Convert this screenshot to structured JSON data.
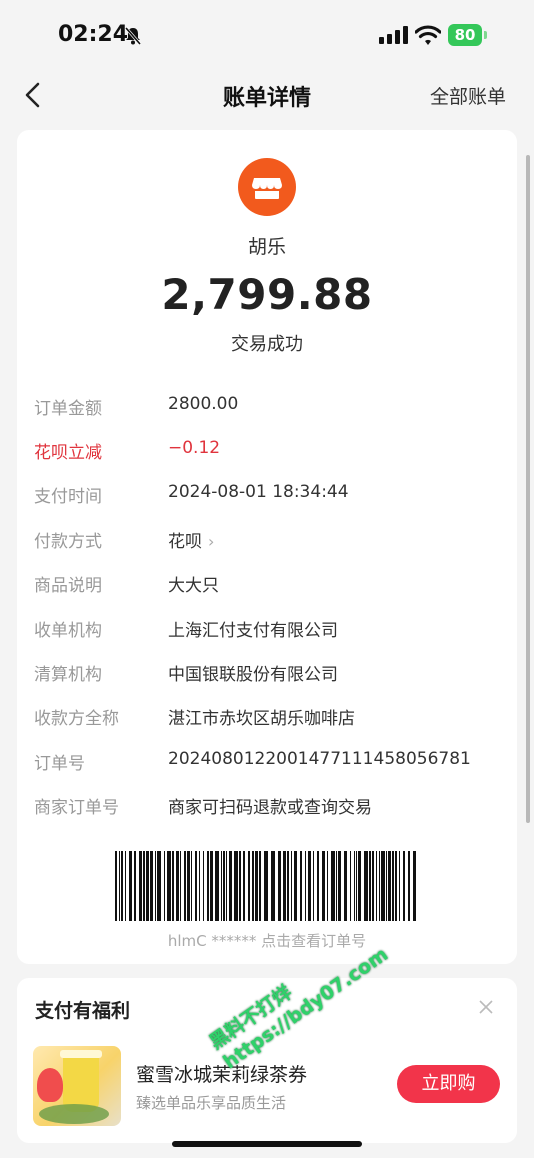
{
  "status_bar": {
    "time": "02:24",
    "battery": "80"
  },
  "nav": {
    "title": "账单详情",
    "right_link": "全部账单"
  },
  "bill": {
    "merchant": "胡乐",
    "amount": "2,799.88",
    "status": "交易成功",
    "rows": [
      {
        "label": "订单金额",
        "value": "2800.00"
      },
      {
        "label": "花呗立减",
        "value": "−0.12"
      },
      {
        "label": "支付时间",
        "value": "2024-08-01 18:34:44"
      },
      {
        "label": "付款方式",
        "value": "花呗"
      },
      {
        "label": "商品说明",
        "value": "大大只"
      },
      {
        "label": "收单机构",
        "value": "上海汇付支付有限公司"
      },
      {
        "label": "清算机构",
        "value": "中国银联股份有限公司"
      },
      {
        "label": "收款方全称",
        "value": "湛江市赤坎区胡乐咖啡店"
      },
      {
        "label": "订单号",
        "value": "2024080122001477111458056781"
      },
      {
        "label": "商家订单号",
        "value": "商家可扫码退款或查询交易"
      }
    ],
    "barcode_caption": "hlmC ****** 点击查看订单号"
  },
  "benefit": {
    "title": "支付有福利",
    "item_name": "蜜雪冰城茉莉绿茶券",
    "item_sub": "臻选单品乐享品质生活",
    "button": "立即购"
  },
  "watermark": {
    "line1": "黑料不打烊",
    "line2": "https://bdy07.com"
  },
  "colors": {
    "accent_red": "#f2344a",
    "icon_orange": "#f25a1d",
    "discount_red": "#e0343d",
    "battery_green": "#34c759"
  }
}
